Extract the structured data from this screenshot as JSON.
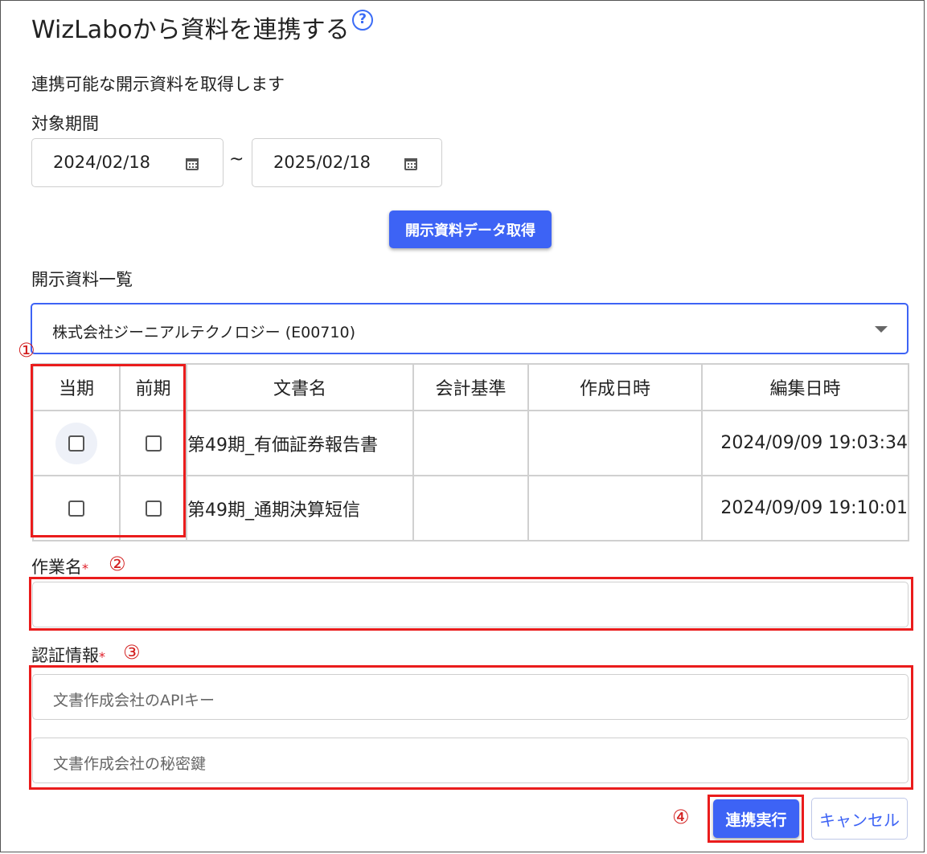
{
  "title": "WizLaboから資料を連携する",
  "help_icon": "?",
  "description": "連携可能な開示資料を取得します",
  "period": {
    "label": "対象期間",
    "start": "2024/02/18",
    "end": "2025/02/18",
    "separator": "~"
  },
  "fetch_button": "開示資料データ取得",
  "list_label": "開示資料一覧",
  "company_select": "株式会社ジーニアルテクノロジー (E00710)",
  "table": {
    "headers": [
      "当期",
      "前期",
      "文書名",
      "会計基準",
      "作成日時",
      "編集日時"
    ],
    "rows": [
      {
        "name": "第49期_有価証券報告書",
        "standard": "",
        "created": "",
        "edited": "2024/09/09 19:03:34"
      },
      {
        "name": "第49期_通期決算短信",
        "standard": "",
        "created": "",
        "edited": "2024/09/09 19:10:01"
      }
    ]
  },
  "task_name": {
    "label": "作業名",
    "required": "*",
    "value": ""
  },
  "auth": {
    "label": "認証情報",
    "required": "*",
    "api_key_placeholder": "文書作成会社のAPIキー",
    "secret_placeholder": "文書作成会社の秘密鍵"
  },
  "execute_button": "連携実行",
  "cancel_button": "キャンセル",
  "annotations": [
    "①",
    "②",
    "③",
    "④"
  ],
  "colors": {
    "accent": "#3d63f5",
    "highlight": "#ea1c1c",
    "required": "#e0202a"
  }
}
